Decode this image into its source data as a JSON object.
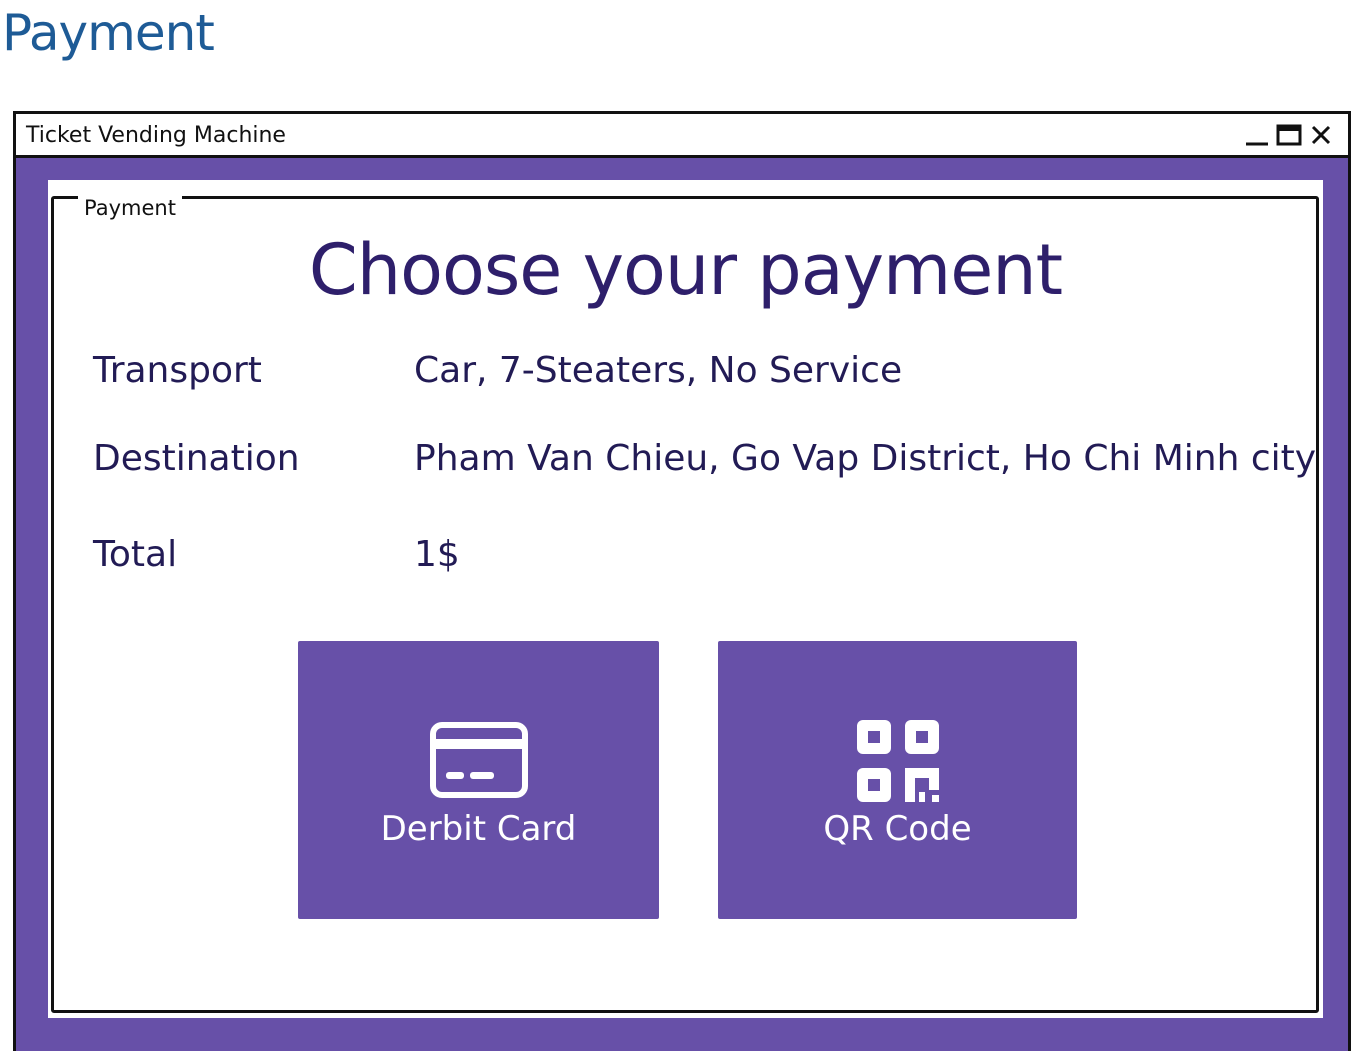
{
  "page_heading": "Payment",
  "window": {
    "title": "Ticket Vending Machine",
    "controls": [
      "minimize-icon",
      "maximize-icon",
      "close-icon"
    ]
  },
  "group": {
    "label": "Payment",
    "heading": "Choose your payment",
    "details": [
      {
        "label": "Transport",
        "value": "Car, 7-Steaters, No Service"
      },
      {
        "label": "Destination",
        "value": "Pham Van Chieu, Go Vap District, Ho Chi Minh city"
      },
      {
        "label": "Total",
        "value": "1$"
      }
    ],
    "buttons": [
      {
        "label": "Derbit Card",
        "icon": "credit-card-icon"
      },
      {
        "label": "QR Code",
        "icon": "qr-code-icon"
      }
    ]
  },
  "colors": {
    "accent": "#6750a8",
    "heading_text": "#2e1f6b",
    "page_heading": "#1e5b96"
  }
}
